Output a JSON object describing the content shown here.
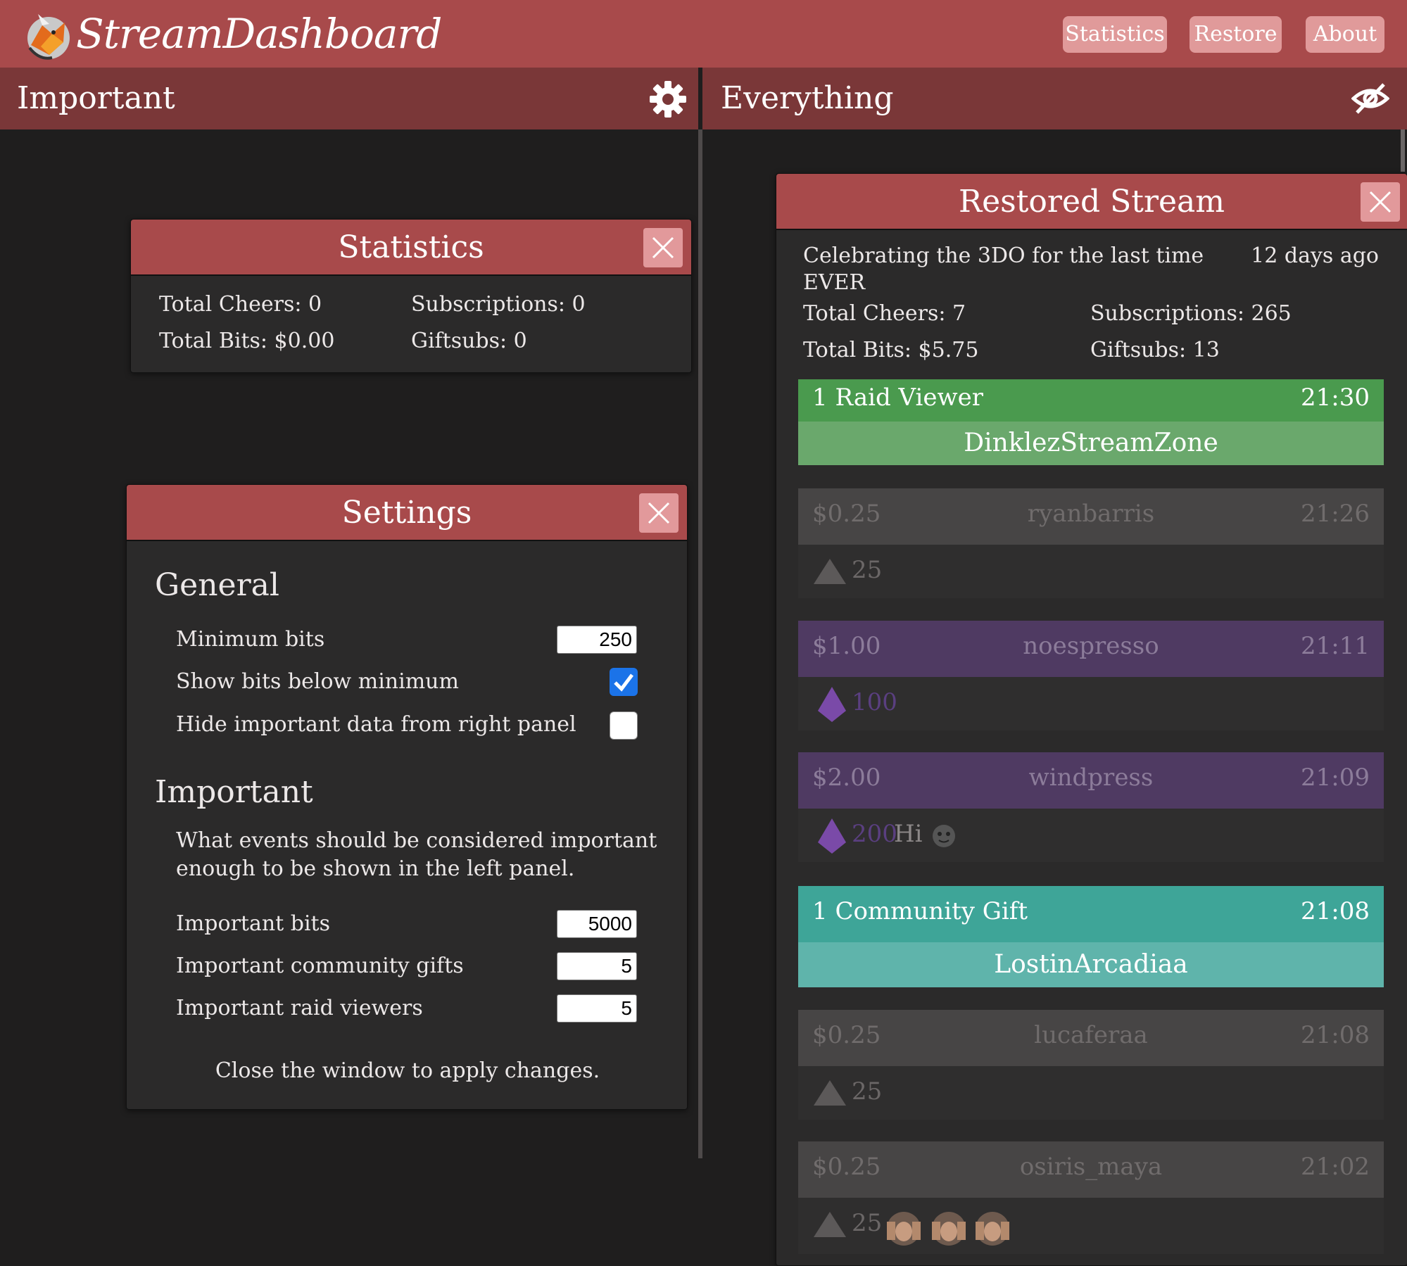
{
  "app": {
    "title": "StreamDashboard",
    "nav": [
      "Statistics",
      "Restore",
      "About"
    ]
  },
  "left_header": "Important",
  "right_header": "Everything",
  "statistics": {
    "title": "Statistics",
    "total_cheers": "Total Cheers: 0",
    "total_bits": "Total Bits: $0.00",
    "subscriptions": "Subscriptions: 0",
    "giftsubs": "Giftsubs: 0"
  },
  "settings": {
    "title": "Settings",
    "general_heading": "General",
    "minimum_bits_label": "Minimum bits",
    "minimum_bits_value": "250",
    "show_bits_below_label": "Show bits below minimum",
    "show_bits_below_checked": true,
    "hide_important_label": "Hide important data from right panel",
    "hide_important_checked": false,
    "important_heading": "Important",
    "important_desc_1": "What events should be considered important",
    "important_desc_2": "enough to be shown in the left panel.",
    "important_bits_label": "Important bits",
    "important_bits_value": "5000",
    "community_gifts_label": "Important community gifts",
    "community_gifts_value": "5",
    "raid_viewers_label": "Important raid viewers",
    "raid_viewers_value": "5",
    "footer": "Close the window to apply changes."
  },
  "restored": {
    "title": "Restored Stream",
    "stream_title_1": "Celebrating the 3DO for the last time",
    "stream_title_2": "EVER",
    "age": "12 days ago",
    "total_cheers": "Total Cheers: 7",
    "total_bits": "Total Bits: $5.75",
    "subscriptions": "Subscriptions: 265",
    "giftsubs": "Giftsubs: 13",
    "events": [
      {
        "kind": "raid",
        "head": "1 Raid Viewer",
        "time": "21:30",
        "name": "DinklezStreamZone"
      },
      {
        "kind": "cheer-grey",
        "amount": "$0.25",
        "user": "ryanbarris",
        "time": "21:26",
        "bits": "25",
        "msg": ""
      },
      {
        "kind": "cheer-purple",
        "amount": "$1.00",
        "user": "noespresso",
        "time": "21:11",
        "bits": "100",
        "msg": ""
      },
      {
        "kind": "cheer-purple",
        "amount": "$2.00",
        "user": "windpress",
        "time": "21:09",
        "bits": "200",
        "msg": "Hi"
      },
      {
        "kind": "gift",
        "head": "1 Community Gift",
        "time": "21:08",
        "name": "LostinArcadiaa"
      },
      {
        "kind": "cheer-grey",
        "amount": "$0.25",
        "user": "lucaferaa",
        "time": "21:08",
        "bits": "25",
        "msg": ""
      },
      {
        "kind": "cheer-grey",
        "amount": "$0.25",
        "user": "osiris_maya",
        "time": "21:02",
        "bits": "25",
        "msg": ""
      }
    ]
  },
  "colors": {
    "brand": "#a84a4b",
    "subbar": "#7a3738",
    "raid_top": "#4a9a4e",
    "raid_bottom": "#6aa86c",
    "gift_top": "#3ea598",
    "gift_bottom": "#5fb4ab",
    "purple_head": "#4f3a62",
    "grey_head": "#474545"
  }
}
